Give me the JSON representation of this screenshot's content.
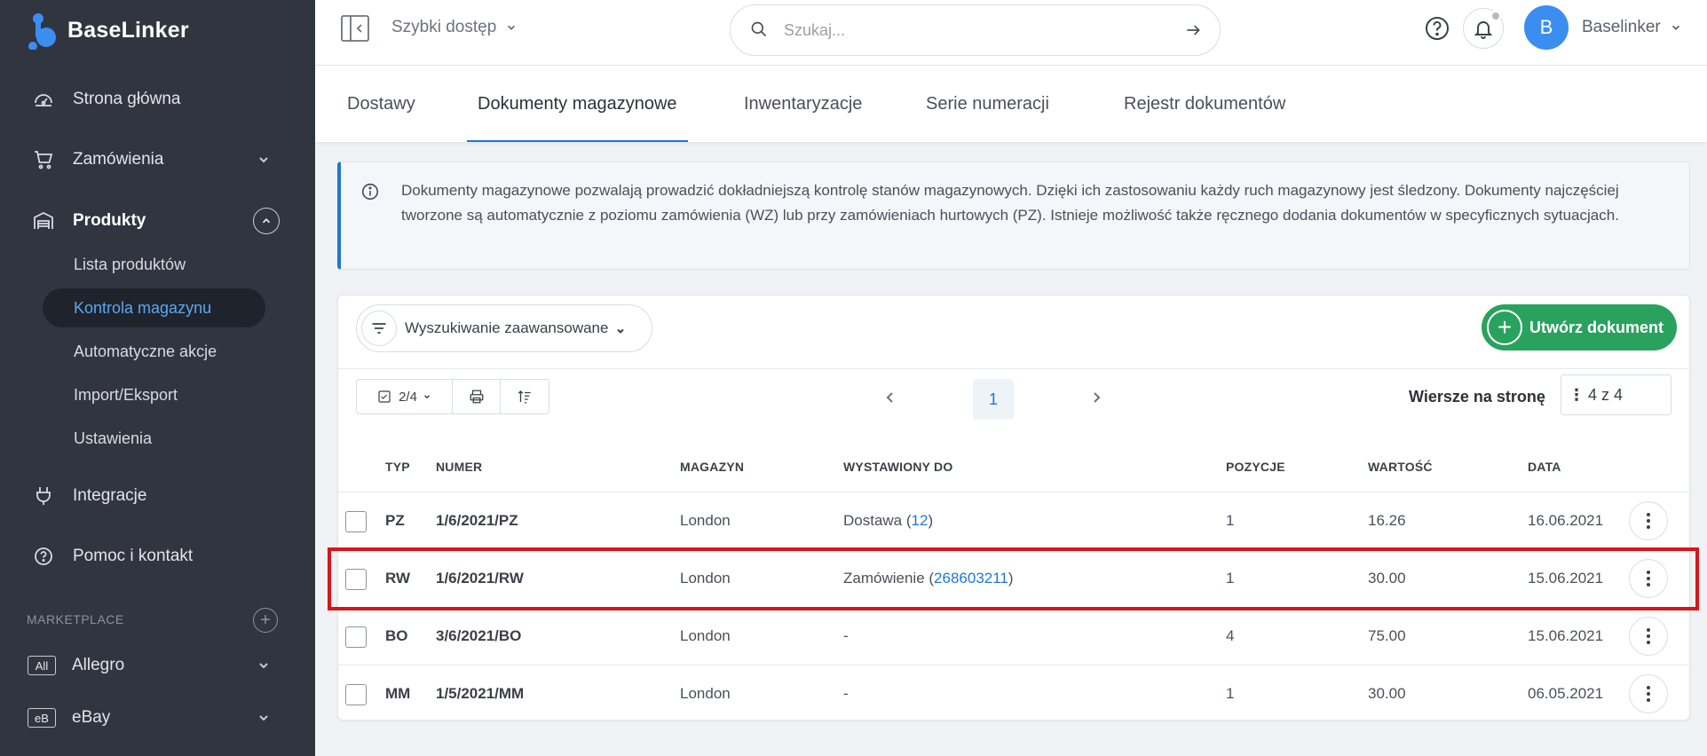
{
  "brand": {
    "name": "BaseLinker"
  },
  "sidebar": {
    "items": [
      {
        "label": "Strona główna"
      },
      {
        "label": "Zamówienia"
      },
      {
        "label": "Produkty"
      },
      {
        "label": "Integracje"
      },
      {
        "label": "Pomoc i kontakt"
      }
    ],
    "subitems": [
      {
        "label": "Lista produktów"
      },
      {
        "label": "Kontrola magazynu"
      },
      {
        "label": "Automatyczne akcje"
      },
      {
        "label": "Import/Eksport"
      },
      {
        "label": "Ustawienia"
      }
    ],
    "section_label": "MARKETPLACE",
    "marketplaces": [
      {
        "badge": "All",
        "label": "Allegro"
      },
      {
        "badge": "eB",
        "label": "eBay"
      }
    ]
  },
  "topbar": {
    "quick_access": "Szybki dostęp",
    "search_placeholder": "Szukaj...",
    "avatar_letter": "B",
    "user_name": "Baselinker"
  },
  "tabs": [
    {
      "label": "Dostawy"
    },
    {
      "label": "Dokumenty magazynowe"
    },
    {
      "label": "Inwentaryzacje"
    },
    {
      "label": "Serie numeracji"
    },
    {
      "label": "Rejestr dokumentów"
    }
  ],
  "info": {
    "text": "Dokumenty magazynowe pozwalają prowadzić dokładniejszą kontrolę stanów magazynowych. Dzięki ich zastosowaniu każdy ruch magazynowy jest śledzony. Dokumenty najczęściej tworzone są automatycznie z poziomu zamówienia (WZ) lub przy zamówieniach hurtowych (PZ). Istnieje możliwość także ręcznego dodania dokumentów w specyficznych sytuacjach."
  },
  "toolbar": {
    "advanced_search": "Wyszukiwanie zaawansowane",
    "create_label": "Utwórz dokument",
    "selection_count": "2/4",
    "current_page": "1",
    "rows_label": "Wiersze na stronę",
    "rows_value": "4 z 4"
  },
  "table": {
    "headers": {
      "type": "TYP",
      "number": "NUMER",
      "warehouse": "MAGAZYN",
      "issued_to": "WYSTAWIONY DO",
      "positions": "POZYCJE",
      "value": "WARTOŚĆ",
      "date": "DATA"
    },
    "rows": [
      {
        "type": "PZ",
        "number": "1/6/2021/PZ",
        "warehouse": "London",
        "issued_prefix": "Dostawa (",
        "issued_link": "12",
        "issued_suffix": ")",
        "positions": "1",
        "value": "16.26",
        "date": "16.06.2021"
      },
      {
        "type": "RW",
        "number": "1/6/2021/RW",
        "warehouse": "London",
        "issued_prefix": "Zamówienie (",
        "issued_link": "268603211",
        "issued_suffix": ")",
        "positions": "1",
        "value": "30.00",
        "date": "15.06.2021"
      },
      {
        "type": "BO",
        "number": "3/6/2021/BO",
        "warehouse": "London",
        "issued_prefix": "-",
        "issued_link": "",
        "issued_suffix": "",
        "positions": "4",
        "value": "75.00",
        "date": "15.06.2021"
      },
      {
        "type": "MM",
        "number": "1/5/2021/MM",
        "warehouse": "London",
        "issued_prefix": "-",
        "issued_link": "",
        "issued_suffix": "",
        "positions": "1",
        "value": "30.00",
        "date": "06.05.2021"
      }
    ]
  },
  "colors": {
    "sidebar_bg": "#30353f",
    "accent_blue": "#1f78d1",
    "create_green": "#29a25e",
    "highlight_red": "#d6151c"
  }
}
